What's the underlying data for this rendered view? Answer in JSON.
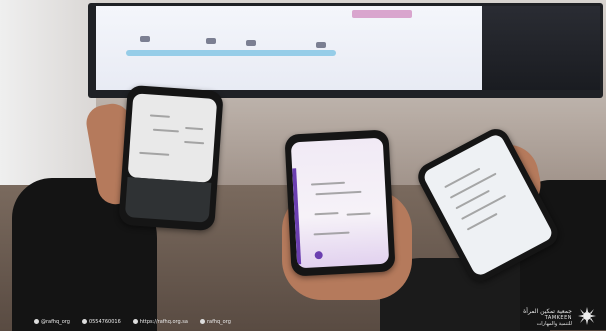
{
  "footer": {
    "handle": "@rafhq_org",
    "phone": "0554760016",
    "website": "https://rafhq.org.sa",
    "social": "rafhq_org"
  },
  "brand": {
    "name_latin": "TAMKEEN",
    "logo_arabic_lines": [
      "جمعية تمكين المرأة",
      "للتنمية والمهارات"
    ]
  },
  "icons": [
    "social-media-icon",
    "phone-icon",
    "globe-icon",
    "location-icon"
  ]
}
